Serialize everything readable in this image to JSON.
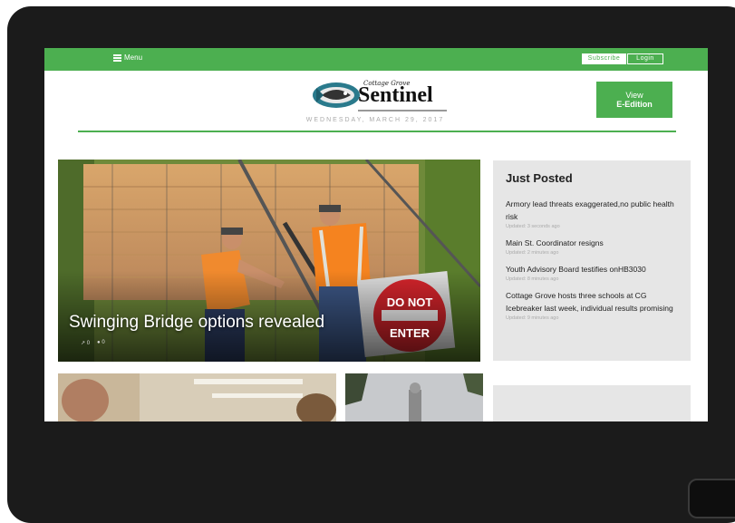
{
  "topbar": {
    "menu_label": "Menu",
    "subscribe_label": "Subscribe",
    "login_label": "Login"
  },
  "logo": {
    "small_text": "Cottage Grove",
    "big_text": "Sentinel"
  },
  "header": {
    "date": "WEDNESDAY, MARCH 29, 2017",
    "view_edition_line1": "View",
    "view_edition_line2": "E-Edition"
  },
  "hero": {
    "title": "Swinging Bridge options revealed",
    "shares": "0",
    "comments": "0",
    "sign_text_top": "DO NOT",
    "sign_text_bottom": "ENTER"
  },
  "just_posted": {
    "heading": "Just Posted",
    "items": [
      {
        "title": "Armory lead threats exaggerated,no public health risk",
        "updated": "Updated: 3 seconds ago"
      },
      {
        "title": "Main St. Coordinator resigns",
        "updated": "Updated: 2 minutes ago"
      },
      {
        "title": "Youth Advisory Board testifies onHB3030",
        "updated": "Updated: 8 minutes ago"
      },
      {
        "title": "Cottage Grove hosts three schools at CG Icebreaker last week, individual results promising",
        "updated": "Updated: 9 minutes ago"
      }
    ]
  },
  "colors": {
    "brand_green": "#4caf50",
    "panel_gray": "#e6e6e6",
    "device_frame": "#1b1b1b"
  },
  "icons": {
    "menu": "hamburger-icon",
    "share": "share-icon",
    "comment": "comment-icon",
    "logo_emblem": "fish-emblem-icon"
  }
}
